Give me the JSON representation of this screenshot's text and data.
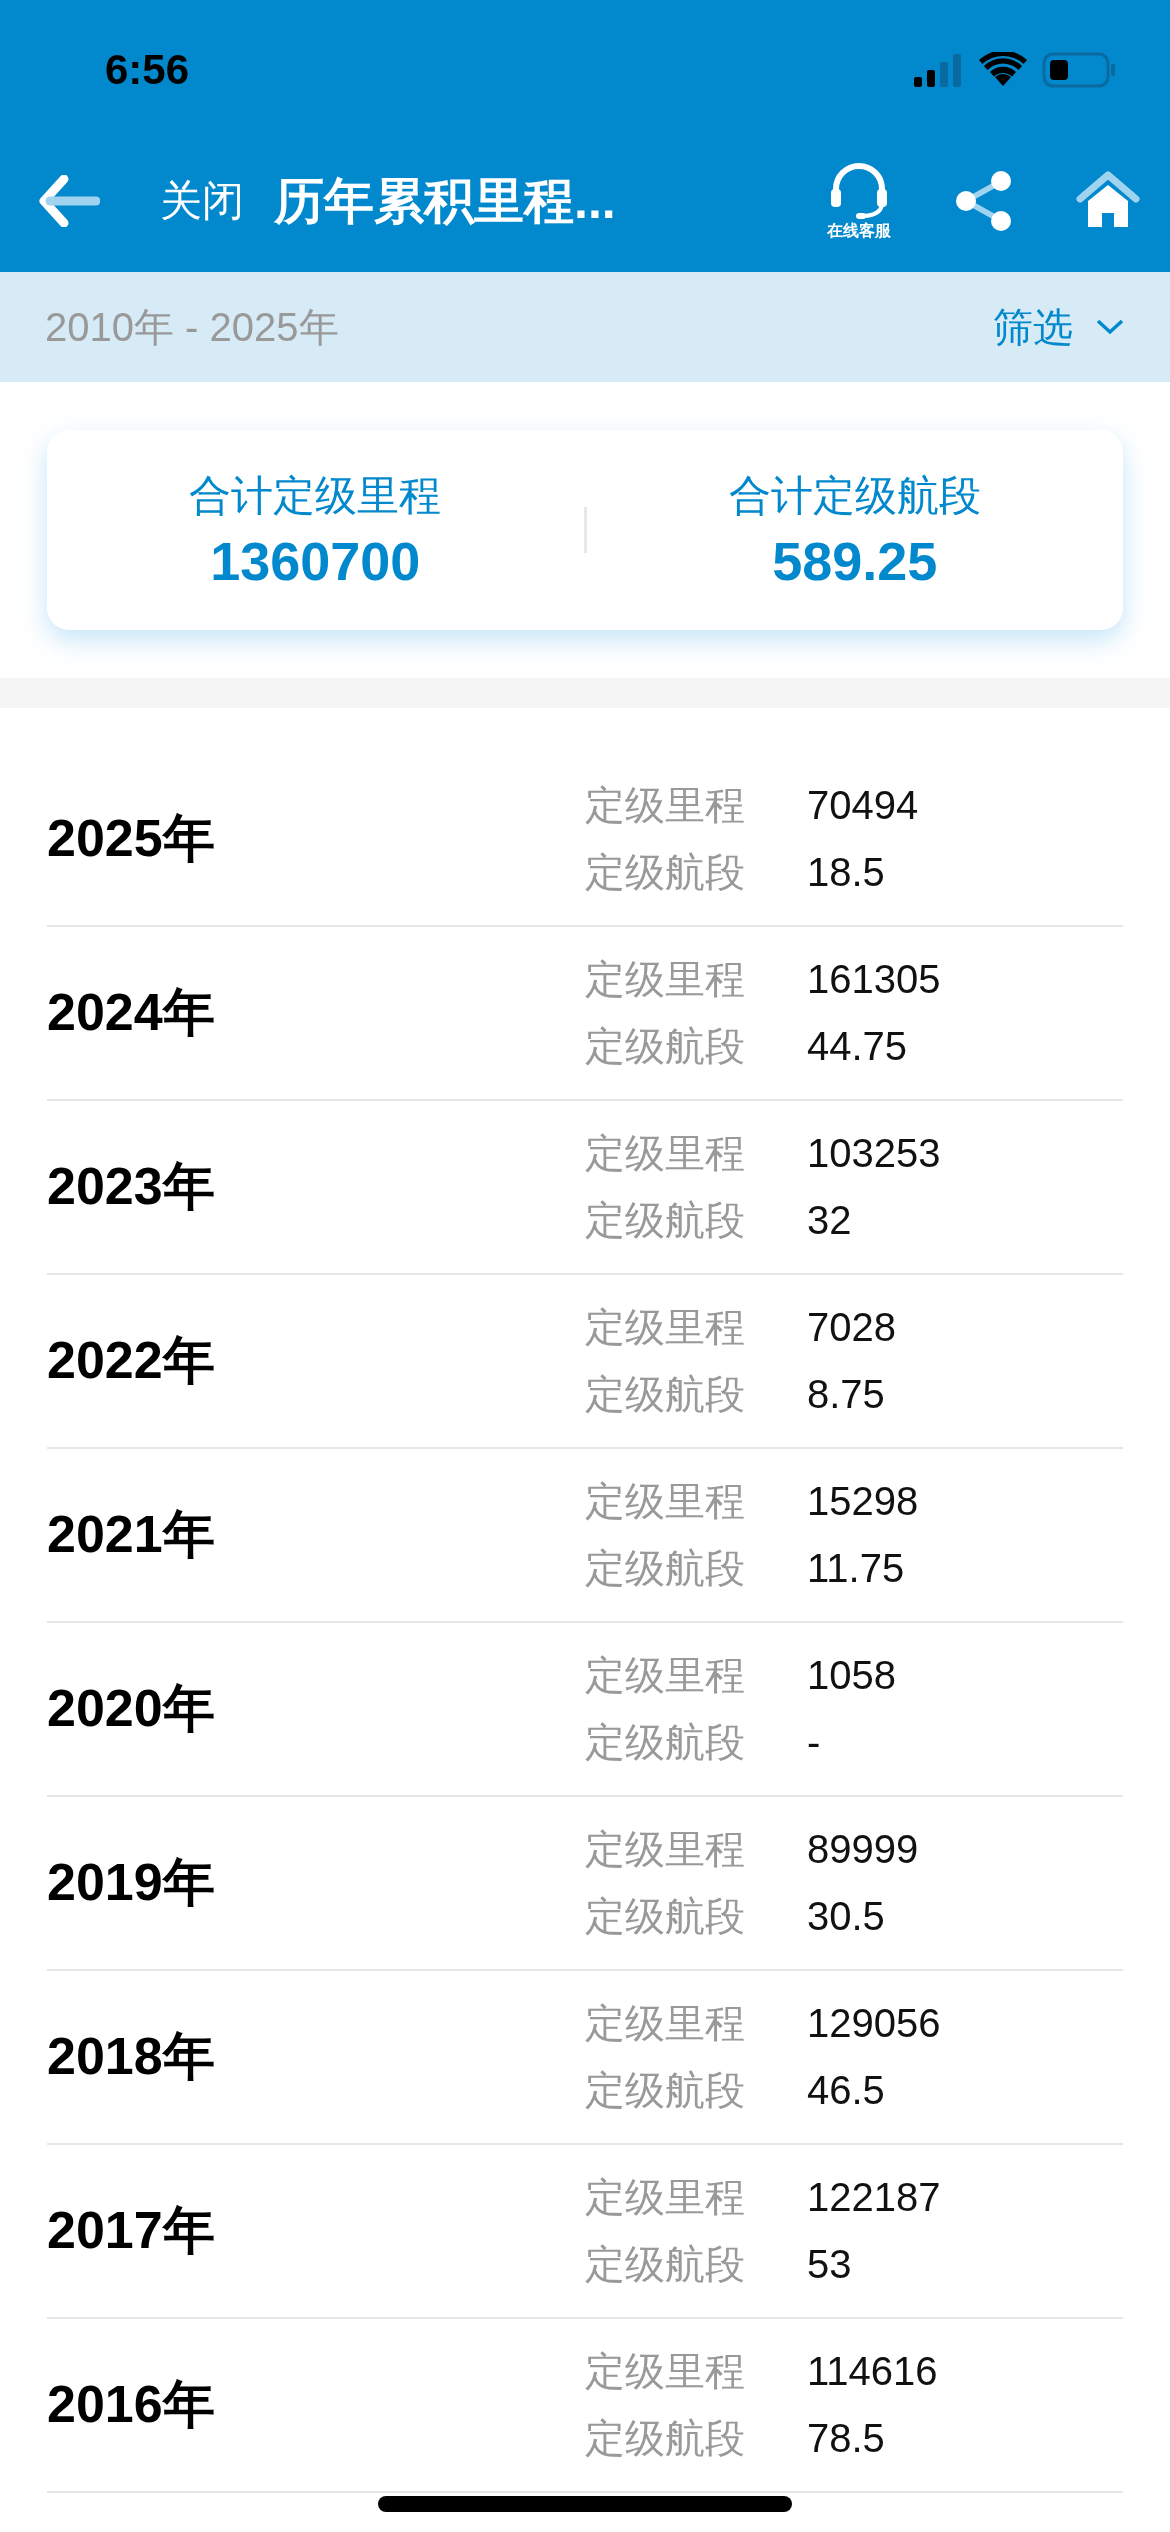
{
  "status_bar": {
    "time": "6:56"
  },
  "nav": {
    "close_label": "关闭",
    "title": "历年累积里程...",
    "service_label": "在线客服"
  },
  "filter_bar": {
    "range": "2010年 - 2025年",
    "filter_label": "筛选"
  },
  "summary": [
    {
      "label": "合计定级里程",
      "value": "1360700"
    },
    {
      "label": "合计定级航段",
      "value": "589.25"
    }
  ],
  "years": [
    {
      "year": "2025年",
      "mileage_label": "定级里程",
      "mileage": "70494",
      "segments_label": "定级航段",
      "segments": "18.5"
    },
    {
      "year": "2024年",
      "mileage_label": "定级里程",
      "mileage": "161305",
      "segments_label": "定级航段",
      "segments": "44.75"
    },
    {
      "year": "2023年",
      "mileage_label": "定级里程",
      "mileage": "103253",
      "segments_label": "定级航段",
      "segments": "32"
    },
    {
      "year": "2022年",
      "mileage_label": "定级里程",
      "mileage": "7028",
      "segments_label": "定级航段",
      "segments": "8.75"
    },
    {
      "year": "2021年",
      "mileage_label": "定级里程",
      "mileage": "15298",
      "segments_label": "定级航段",
      "segments": "11.75"
    },
    {
      "year": "2020年",
      "mileage_label": "定级里程",
      "mileage": "1058",
      "segments_label": "定级航段",
      "segments": "-"
    },
    {
      "year": "2019年",
      "mileage_label": "定级里程",
      "mileage": "89999",
      "segments_label": "定级航段",
      "segments": "30.5"
    },
    {
      "year": "2018年",
      "mileage_label": "定级里程",
      "mileage": "129056",
      "segments_label": "定级航段",
      "segments": "46.5"
    },
    {
      "year": "2017年",
      "mileage_label": "定级里程",
      "mileage": "122187",
      "segments_label": "定级航段",
      "segments": "53"
    },
    {
      "year": "2016年",
      "mileage_label": "定级里程",
      "mileage": "114616",
      "segments_label": "定级航段",
      "segments": "78.5"
    }
  ]
}
